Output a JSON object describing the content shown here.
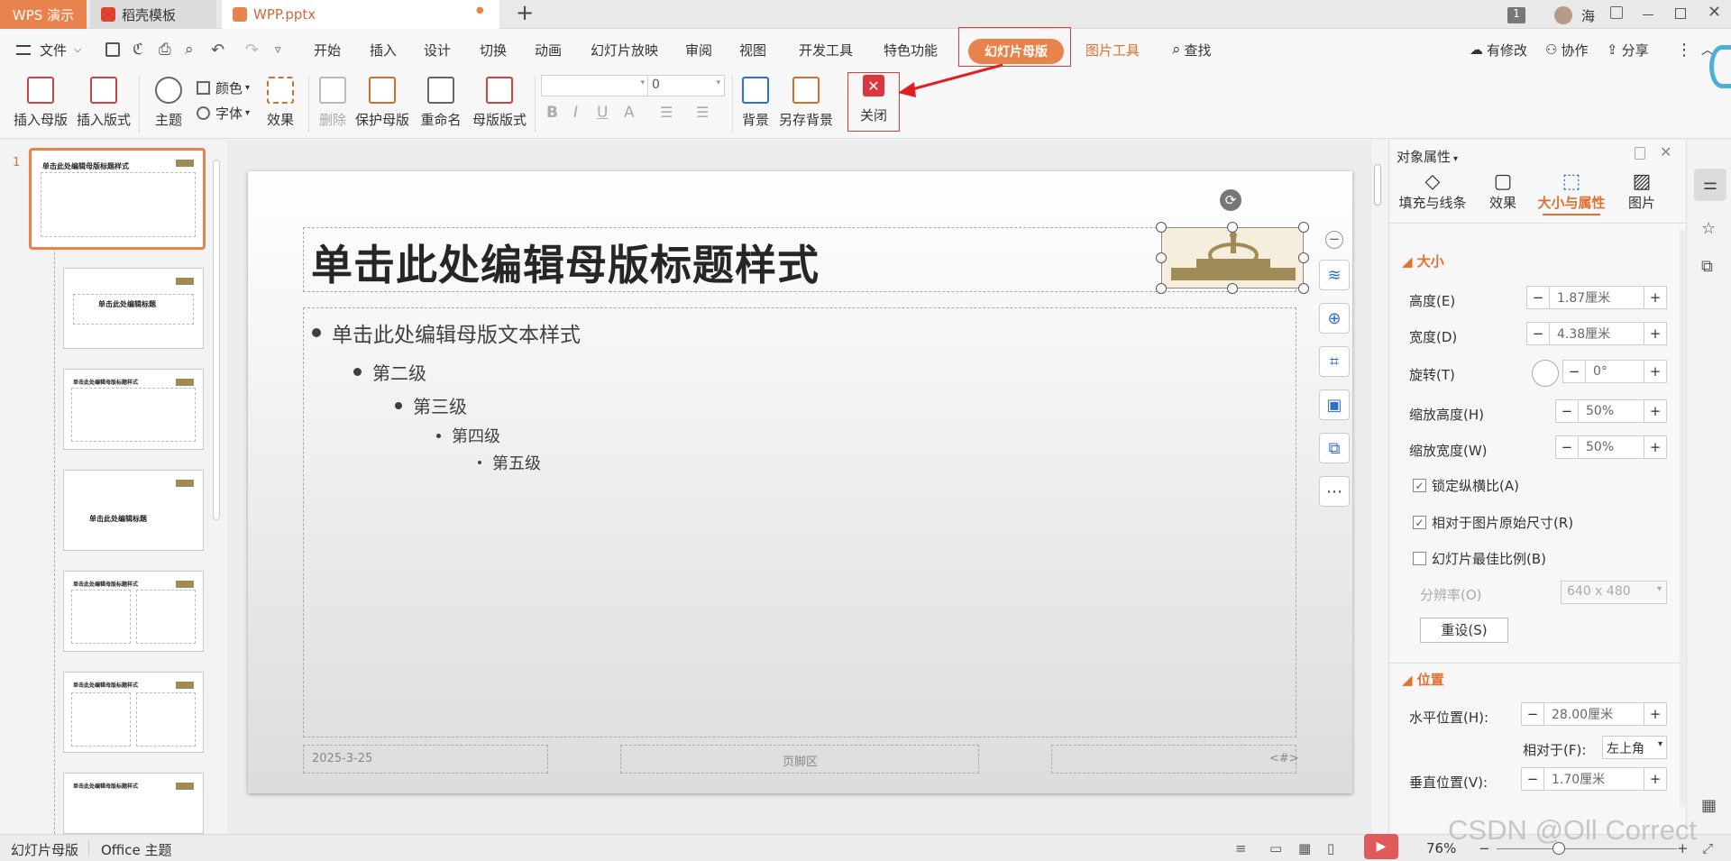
{
  "tabs": {
    "wps": "WPS 演示",
    "daoke": "稻壳模板",
    "file": "WPP.pptx",
    "dot": "●",
    "add": "+"
  },
  "window": {
    "badge": "1",
    "user": "海"
  },
  "menu": {
    "file": "文件",
    "start": "开始",
    "insert": "插入",
    "design": "设计",
    "switch": "切换",
    "animation": "动画",
    "slideshow": "幻灯片放映",
    "review": "审阅",
    "view": "视图",
    "devtools": "开发工具",
    "special": "特色功能",
    "master": "幻灯片母版",
    "picture_tools": "图片工具",
    "find": "查找",
    "modified": "有修改",
    "collab": "协作",
    "share": "分享"
  },
  "ribbon": {
    "insert_master": "插入母版",
    "insert_layout": "插入版式",
    "theme": "主题",
    "color": "颜色",
    "font": "字体",
    "effect": "效果",
    "delete": "删除",
    "protect_master": "保护母版",
    "rename": "重命名",
    "master_layout": "母版版式",
    "font_size": "0",
    "background": "背景",
    "save_background": "另存背景",
    "close": "关闭"
  },
  "slide": {
    "title": "单击此处编辑母版标题样式",
    "level1": "单击此处编辑母版文本样式",
    "level2": "第二级",
    "level3": "第三级",
    "level4": "第四级",
    "level5": "第五级",
    "date": "2025-3-25",
    "footer": "页脚区",
    "number": "<#>"
  },
  "thumbs": {
    "num": "1",
    "t1": "单击此处编辑母版标题样式",
    "t2": "单击此处编辑标题",
    "t3": "单击此处编辑母版标题样式",
    "t4": "单击此处编辑标题",
    "t5": "单击此处编辑母版标题样式",
    "t6": "单击此处编辑母版标题样式",
    "t7": "单击此处编辑母版标题样式"
  },
  "panel": {
    "title": "对象属性",
    "tab_fill": "填充与线条",
    "tab_effect": "效果",
    "tab_size": "大小与属性",
    "tab_picture": "图片",
    "size_section": "大小",
    "height_label": "高度(E)",
    "height_val": "1.87厘米",
    "width_label": "宽度(D)",
    "width_val": "4.38厘米",
    "rotate_label": "旋转(T)",
    "rotate_val": "0°",
    "scale_h_label": "缩放高度(H)",
    "scale_h_val": "50%",
    "scale_w_label": "缩放宽度(W)",
    "scale_w_val": "50%",
    "lock_ratio": "锁定纵横比(A)",
    "relative_orig": "相对于图片原始尺寸(R)",
    "best_scale": "幻灯片最佳比例(B)",
    "resolution_label": "分辨率(O)",
    "resolution_val": "640 x 480",
    "reset": "重设(S)",
    "pos_section": "位置",
    "hpos_label": "水平位置(H):",
    "hpos_val": "28.00厘米",
    "relative_label": "相对于(F):",
    "relative_val": "左上角",
    "vpos_label": "垂直位置(V):",
    "vpos_val": "1.70厘米"
  },
  "status": {
    "master": "幻灯片母版",
    "theme": "Office 主题",
    "zoom": "76%"
  },
  "watermark": "CSDN @Oll Correct"
}
